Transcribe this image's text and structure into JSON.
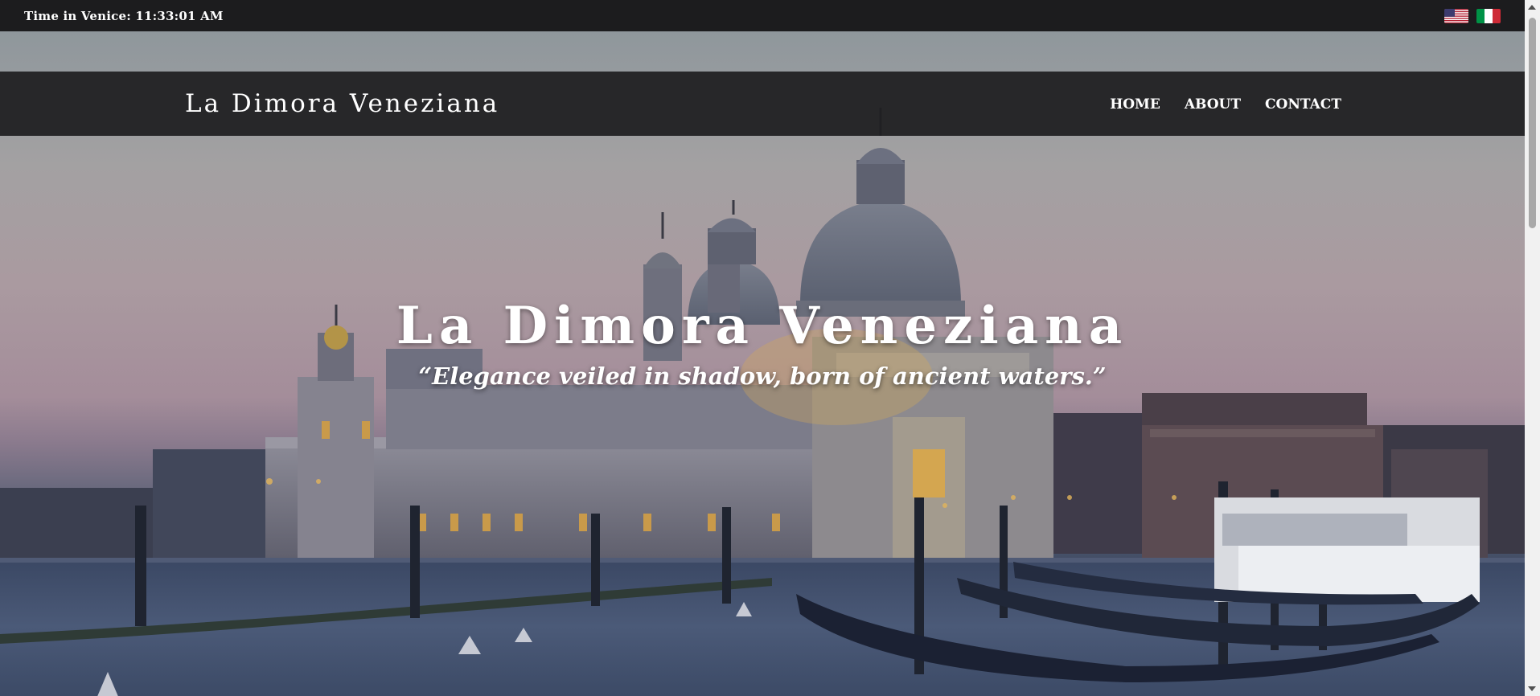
{
  "topbar": {
    "clock": "Time in Venice: 11:33:01 AM",
    "flags": [
      {
        "icon": "us-flag-icon",
        "language": "English"
      },
      {
        "icon": "italy-flag-icon",
        "language": "Italiano"
      }
    ]
  },
  "nav": {
    "brand": "La Dimora Veneziana",
    "items": [
      {
        "label": "HOME"
      },
      {
        "label": "ABOUT"
      },
      {
        "label": "CONTACT"
      }
    ]
  },
  "hero": {
    "title": "La Dimora Veneziana",
    "tagline": "“Elegance veiled in shadow, born of ancient waters.”",
    "background": "venice-santa-maria-della-salute-dusk-photo"
  },
  "colors": {
    "topbar": "#1c1c1e",
    "navbar": "#1e1e20",
    "text": "#ffffff"
  }
}
